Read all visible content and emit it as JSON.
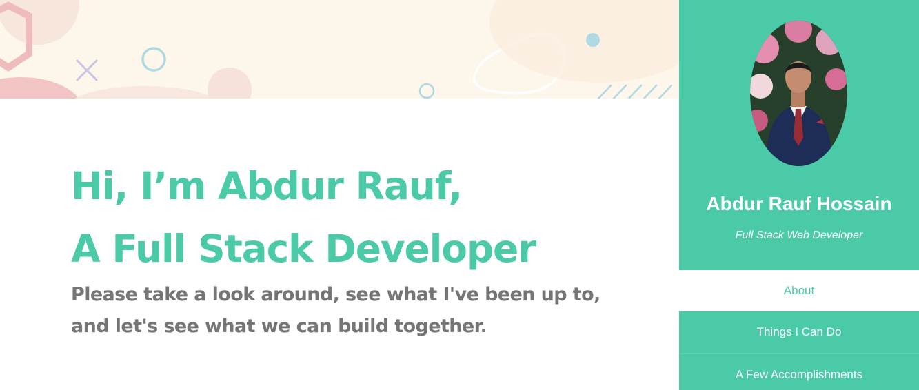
{
  "colors": {
    "accent": "#4bcaa8",
    "banner_background": "#fdf6ea",
    "tagline": "#757575",
    "sidebar_text": "#ffffff"
  },
  "hero": {
    "headline_line1": "Hi, I’m Abdur Rauf,",
    "headline_line2": "A Full Stack Developer",
    "tagline": "Please take a look around, see what I've been up to, and let's see what we can build together."
  },
  "sidebar": {
    "name": "Abdur Rauf Hossain",
    "role": "Full Stack Web Developer",
    "nav": [
      {
        "label": "About",
        "active": true
      },
      {
        "label": "Things I Can Do",
        "active": false
      },
      {
        "label": "A Few Accomplishments",
        "active": false
      }
    ]
  }
}
